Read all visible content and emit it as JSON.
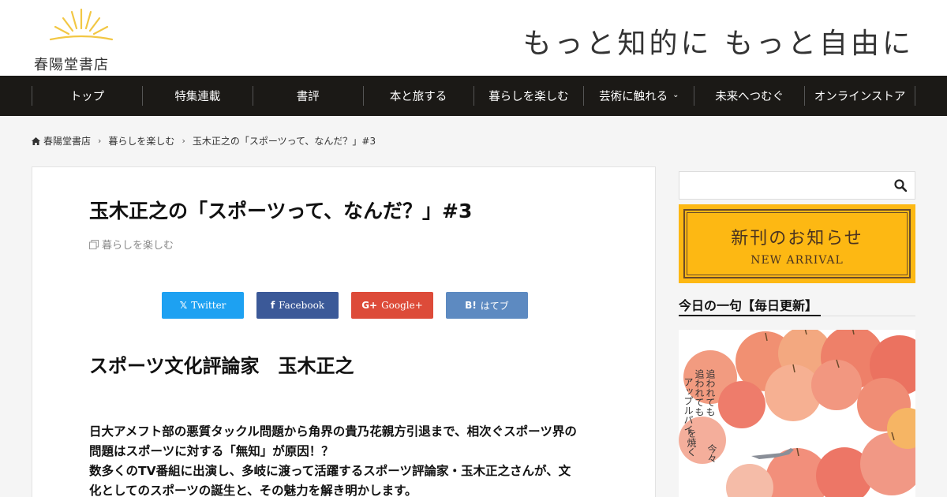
{
  "header": {
    "logo_text": "春陽堂書店",
    "tagline": "もっと知的に もっと自由に"
  },
  "nav": {
    "items": [
      {
        "label": "トップ"
      },
      {
        "label": "特集連載"
      },
      {
        "label": "書評"
      },
      {
        "label": "本と旅する"
      },
      {
        "label": "暮らしを楽しむ"
      },
      {
        "label": "芸術に触れる"
      },
      {
        "label": "未来へつむぐ"
      },
      {
        "label": "オンラインストア"
      }
    ]
  },
  "breadcrumb": {
    "home": "春陽堂書店",
    "category": "暮らしを楽しむ",
    "current": "玉木正之の「スポーツって、なんだ？」#3"
  },
  "article": {
    "title": "玉木正之の「スポーツって、なんだ？」#3",
    "category": "暮らしを楽しむ",
    "share": {
      "twitter": "Twitter",
      "facebook": "Facebook",
      "google": "Google+",
      "hatena_mark": "B!",
      "hatena": "はてブ"
    },
    "subheading": "スポーツ文化評論家　玉木正之",
    "lines": [
      "日大アメフト部の悪質タックル問題から角界の貴乃花親方引退まで、相次ぐスポーツ界の",
      "問題はスポーツに対する「無知」が原因！？",
      "数多くのTV番組に出演し、多岐に渡って活躍するスポーツ評論家・玉木正之さんが、文",
      "化としてのスポーツの誕生と、その魅力を解き明かします。"
    ]
  },
  "sidebar": {
    "search_placeholder": "",
    "banner_title": "新刊のお知らせ",
    "banner_sub": "NEW ARRIVAL",
    "widget_title": "今日の一句【毎日更新】"
  },
  "colors": {
    "nav_bg": "#1b1916",
    "banner_bg": "#fdb813",
    "twitter": "#1da1f2",
    "facebook": "#3b5998",
    "google": "#dd4b39",
    "hatena": "#5d8ac1"
  }
}
